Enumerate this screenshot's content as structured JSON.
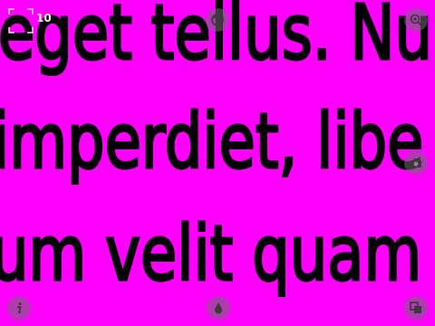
{
  "viewer": {
    "page_counter": "10",
    "background_color": "#ff00ff",
    "text_lines": [
      "eget tellus. Nu",
      "imperdiet, libe",
      "um velit quam"
    ]
  },
  "toolbar": {
    "top_center_icon": "no-symbol-icon",
    "top_right_icon": "zoom-in-icon",
    "mid_right_icon": "camera-icon",
    "bottom_left_icon": "info-icon",
    "bottom_center_icon": "drop-icon",
    "bottom_right_icon": "copy-icon"
  }
}
